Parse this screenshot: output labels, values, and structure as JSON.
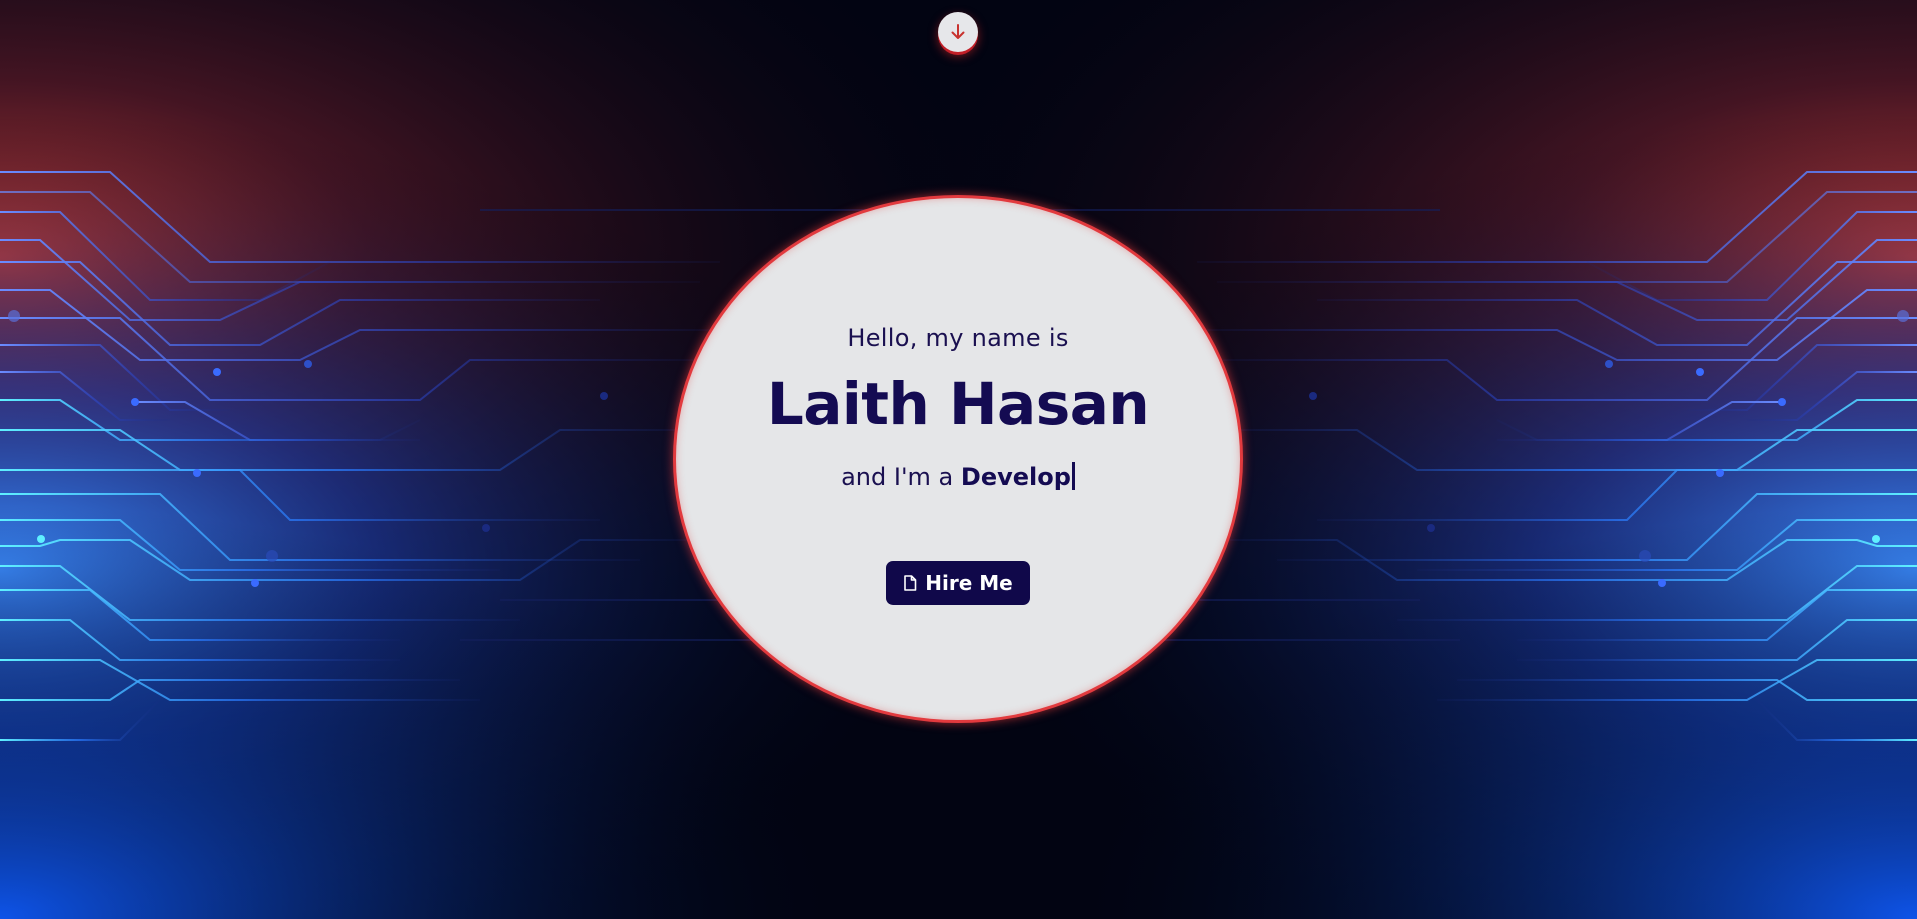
{
  "hero": {
    "greeting": "Hello, my name is",
    "name": "Laith Hasan",
    "role_prefix": "and I'm a",
    "role_word": "Develop",
    "hire_button_label": "Hire Me"
  },
  "scroll_button": {
    "icon": "arrow-down-icon"
  },
  "colors": {
    "background": "#020412",
    "circle_fill": "#e5e6e8",
    "circle_ring": "#e23a3e",
    "text_navy": "#140b52",
    "button_bg": "#10084a",
    "glow_red": "#e8433a",
    "glow_blue": "#2a6bff",
    "glow_cyan": "#3fd6ff"
  }
}
